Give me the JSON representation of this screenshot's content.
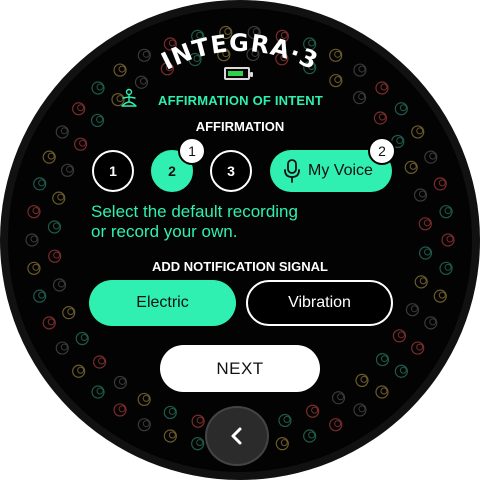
{
  "app": {
    "brand_title": "INTEGRA·3"
  },
  "status": {
    "battery_level": 0.85,
    "battery_color": "#2fd14a"
  },
  "section": {
    "icon": "meditation-person-icon",
    "title": "AFFIRMATION OF INTENT"
  },
  "affirmation": {
    "label": "AFFIRMATION",
    "options": [
      "1",
      "2",
      "3"
    ],
    "selected_index": 1,
    "selected_badge": "1",
    "voice_label": "My Voice",
    "voice_icon": "microphone-icon",
    "voice_badge": "2"
  },
  "instructions": {
    "line1": "Select the default recording",
    "line2": "or record your own."
  },
  "signal": {
    "label": "ADD NOTIFICATION SIGNAL",
    "options": [
      "Electric",
      "Vibration"
    ],
    "selected": "Electric"
  },
  "actions": {
    "next_label": "NEXT",
    "back_icon": "chevron-left-icon"
  },
  "colors": {
    "accent": "#2ff0b0",
    "background": "#030303",
    "text": "#ffffff"
  }
}
